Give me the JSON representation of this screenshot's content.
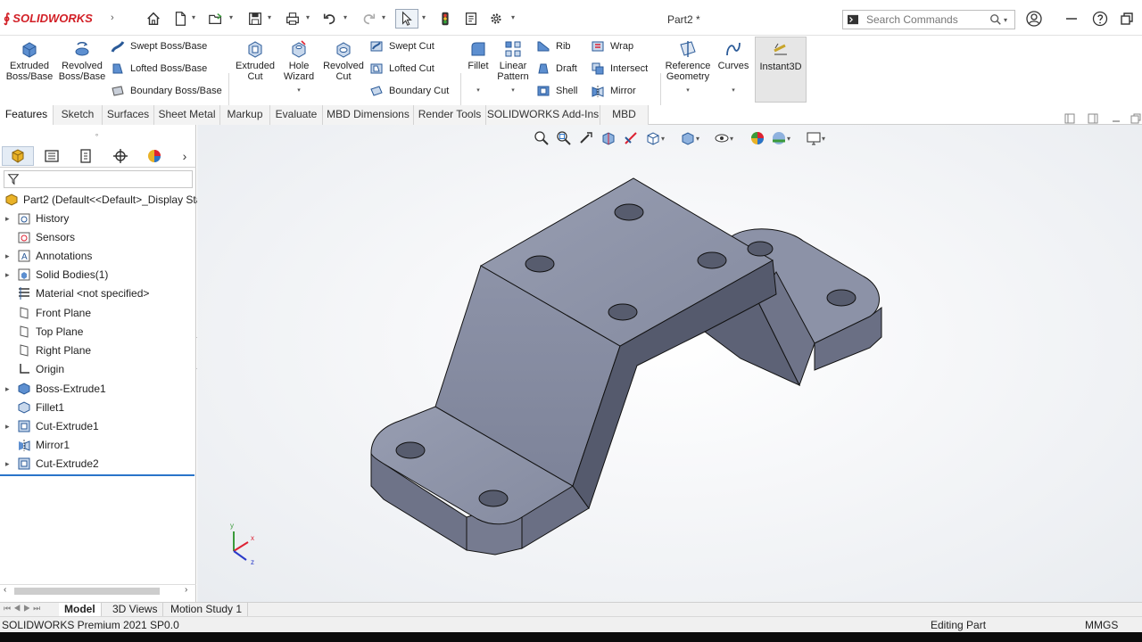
{
  "app": {
    "brand": "SOLIDWORKS",
    "doc_title": "Part2 *",
    "search_placeholder": "Search Commands"
  },
  "ribbon": {
    "extruded_boss": "Extruded Boss/Base",
    "revolved_boss": "Revolved Boss/Base",
    "swept_boss": "Swept Boss/Base",
    "lofted_boss": "Lofted Boss/Base",
    "boundary_boss": "Boundary Boss/Base",
    "extruded_cut": "Extruded Cut",
    "hole_wizard": "Hole Wizard",
    "revolved_cut": "Revolved Cut",
    "swept_cut": "Swept Cut",
    "lofted_cut": "Lofted Cut",
    "boundary_cut": "Boundary Cut",
    "fillet": "Fillet",
    "linear_pattern": "Linear Pattern",
    "rib": "Rib",
    "draft": "Draft",
    "shell": "Shell",
    "wrap": "Wrap",
    "intersect": "Intersect",
    "mirror": "Mirror",
    "reference_geometry": "Reference Geometry",
    "curves": "Curves",
    "instant3d": "Instant3D"
  },
  "tabs": [
    "Features",
    "Sketch",
    "Surfaces",
    "Sheet Metal",
    "Markup",
    "Evaluate",
    "MBD Dimensions",
    "Render Tools",
    "SOLIDWORKS Add-Ins",
    "MBD"
  ],
  "tree": {
    "root": "Part2  (Default<<Default>_Display Sta",
    "items": [
      "History",
      "Sensors",
      "Annotations",
      "Solid Bodies(1)",
      "Material <not specified>",
      "Front Plane",
      "Top Plane",
      "Right Plane",
      "Origin",
      "Boss-Extrude1",
      "Fillet1",
      "Cut-Extrude1",
      "Mirror1",
      "Cut-Extrude2"
    ]
  },
  "triad": {
    "x": "x",
    "y": "y",
    "z": "z"
  },
  "bottom_tabs": [
    "Model",
    "3D Views",
    "Motion Study 1"
  ],
  "status": {
    "version": "SOLIDWORKS Premium 2021 SP0.0",
    "mode": "Editing Part",
    "units": "MMGS"
  },
  "colors": {
    "brand_red": "#d21f26",
    "part_top": "#8e94a8",
    "part_side": "#6c7086",
    "part_dark": "#555a6d",
    "accent_blue": "#2a74c9"
  }
}
